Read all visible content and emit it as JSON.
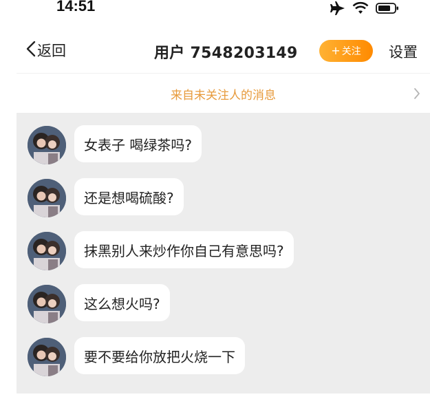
{
  "status_bar": {
    "time": "14:51",
    "icons": [
      "airplane-icon",
      "wifi-icon",
      "battery-icon"
    ]
  },
  "nav": {
    "back_label": "返回",
    "title": "用户 7548203149",
    "follow_label": "关注",
    "follow_prefix": "+",
    "settings_label": "设置"
  },
  "notice": {
    "text": "来自未关注人的消息"
  },
  "messages": [
    {
      "text": "女表子 喝绿茶吗?"
    },
    {
      "text": "还是想喝硫酸?"
    },
    {
      "text": "抹黑别人来炒作你自己有意思吗?"
    },
    {
      "text": "这么想火吗?"
    },
    {
      "text": "要不要给你放把火烧一下"
    }
  ],
  "colors": {
    "accent_orange": "#ff8a00",
    "notice_text": "#e79a3b",
    "chat_background": "#ededed",
    "bubble_background": "#ffffff"
  }
}
